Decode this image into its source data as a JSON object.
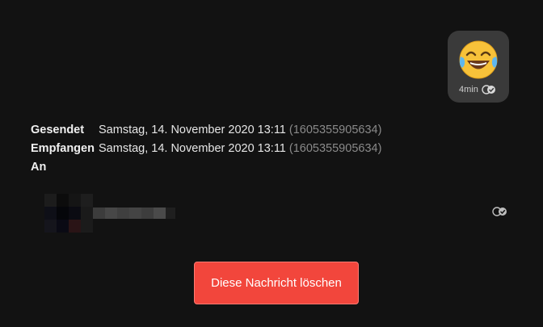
{
  "message": {
    "emoji": "😂",
    "emoji_icon": "face-with-tears-of-joy-icon",
    "age": "4min",
    "status_icon": "double-check-icon"
  },
  "details": {
    "sent_label": "Gesendet",
    "sent_value": "Samstag, 14. November 2020 13:11",
    "sent_timestamp": "(1605355905634)",
    "received_label": "Empfangen",
    "received_value": "Samstag, 14. November 2020 13:11",
    "received_timestamp": "(1605355905634)",
    "to_label": "An"
  },
  "recipient": {
    "avatar_icon": "pixelated-avatar-icon",
    "status_icon": "double-check-icon"
  },
  "actions": {
    "delete_label": "Diese Nachricht löschen",
    "delete_color": "#f2463c"
  },
  "colors": {
    "background": "#121212",
    "bubble": "#3a3a3a"
  }
}
